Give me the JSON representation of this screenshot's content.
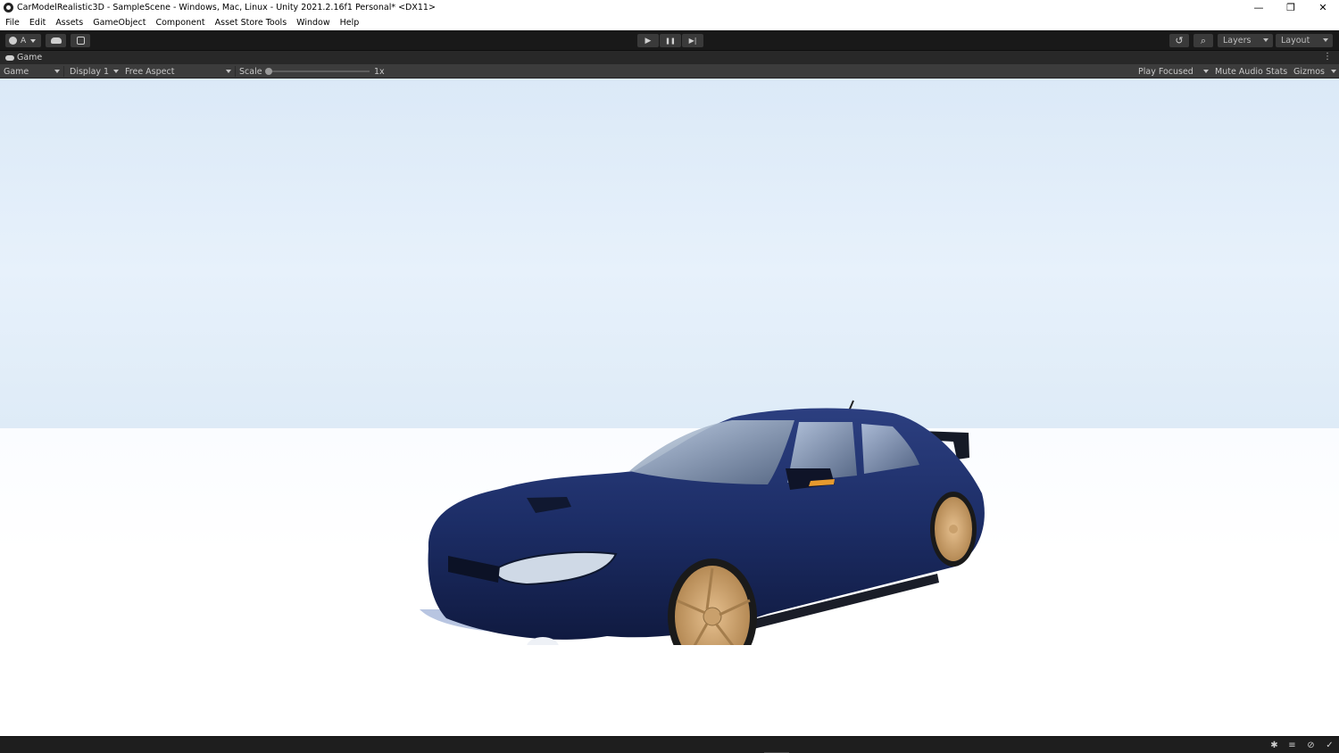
{
  "window": {
    "title": "CarModelRealistic3D - SampleScene - Windows, Mac, Linux - Unity 2021.2.16f1 Personal* <DX11>",
    "controls": {
      "minimize": "—",
      "restore": "❐",
      "close": "✕"
    }
  },
  "menu": {
    "items": [
      "File",
      "Edit",
      "Assets",
      "GameObject",
      "Component",
      "Asset Store Tools",
      "Window",
      "Help"
    ]
  },
  "toolbar": {
    "account_label": "A",
    "play_icon": "▶",
    "pause_icon": "❚❚",
    "step_icon": "▶|",
    "history_icon": "↺",
    "search_icon": "⌕",
    "layers_label": "Layers",
    "layout_label": "Layout"
  },
  "game_tab": {
    "label": "Game",
    "kebab": "⋮"
  },
  "game_toolbar": {
    "view_mode": "Game",
    "display": "Display 1",
    "aspect": "Free Aspect",
    "scale_label": "Scale",
    "scale_value": "1x",
    "scale_fraction": 0.0,
    "play_focused": "Play Focused",
    "mute_audio": "Mute Audio",
    "stats": "Stats",
    "gizmos": "Gizmos"
  },
  "scene": {
    "sky_color": "#dfecf8",
    "ground_color": "#ffffff",
    "car_body_color": "#1c2d66",
    "wheel_color": "#d2a873"
  },
  "statusbar": {
    "icons": [
      "bug-icon",
      "layers-icon",
      "no-lighting-icon",
      "check-icon"
    ]
  }
}
